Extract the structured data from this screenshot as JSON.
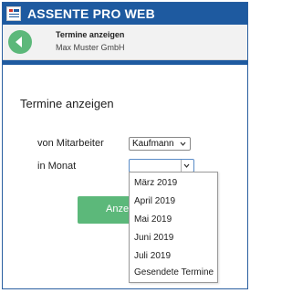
{
  "app": {
    "title": "ASSENTE PRO WEB"
  },
  "subheader": {
    "title": "Termine anzeigen",
    "company": "Max Muster GmbH"
  },
  "main": {
    "heading": "Termine anzeigen",
    "employee_label": "von Mitarbeiter",
    "employee_value": "Kaufmann",
    "month_label": "in Monat",
    "month_value": "",
    "submit_label": "Anze"
  },
  "dropdown": {
    "options": [
      "März 2019",
      "April 2019",
      "Mai 2019",
      "Juni 2019",
      "Juli 2019",
      "Gesendete Termine"
    ]
  },
  "colors": {
    "header": "#1e5aa0",
    "accent_green": "#5cb87a",
    "subheader_bg": "#f2f2f2"
  },
  "icons": {
    "back": "arrow-left-icon",
    "app": "app-logo-icon",
    "chevron": "chevron-down-icon"
  }
}
